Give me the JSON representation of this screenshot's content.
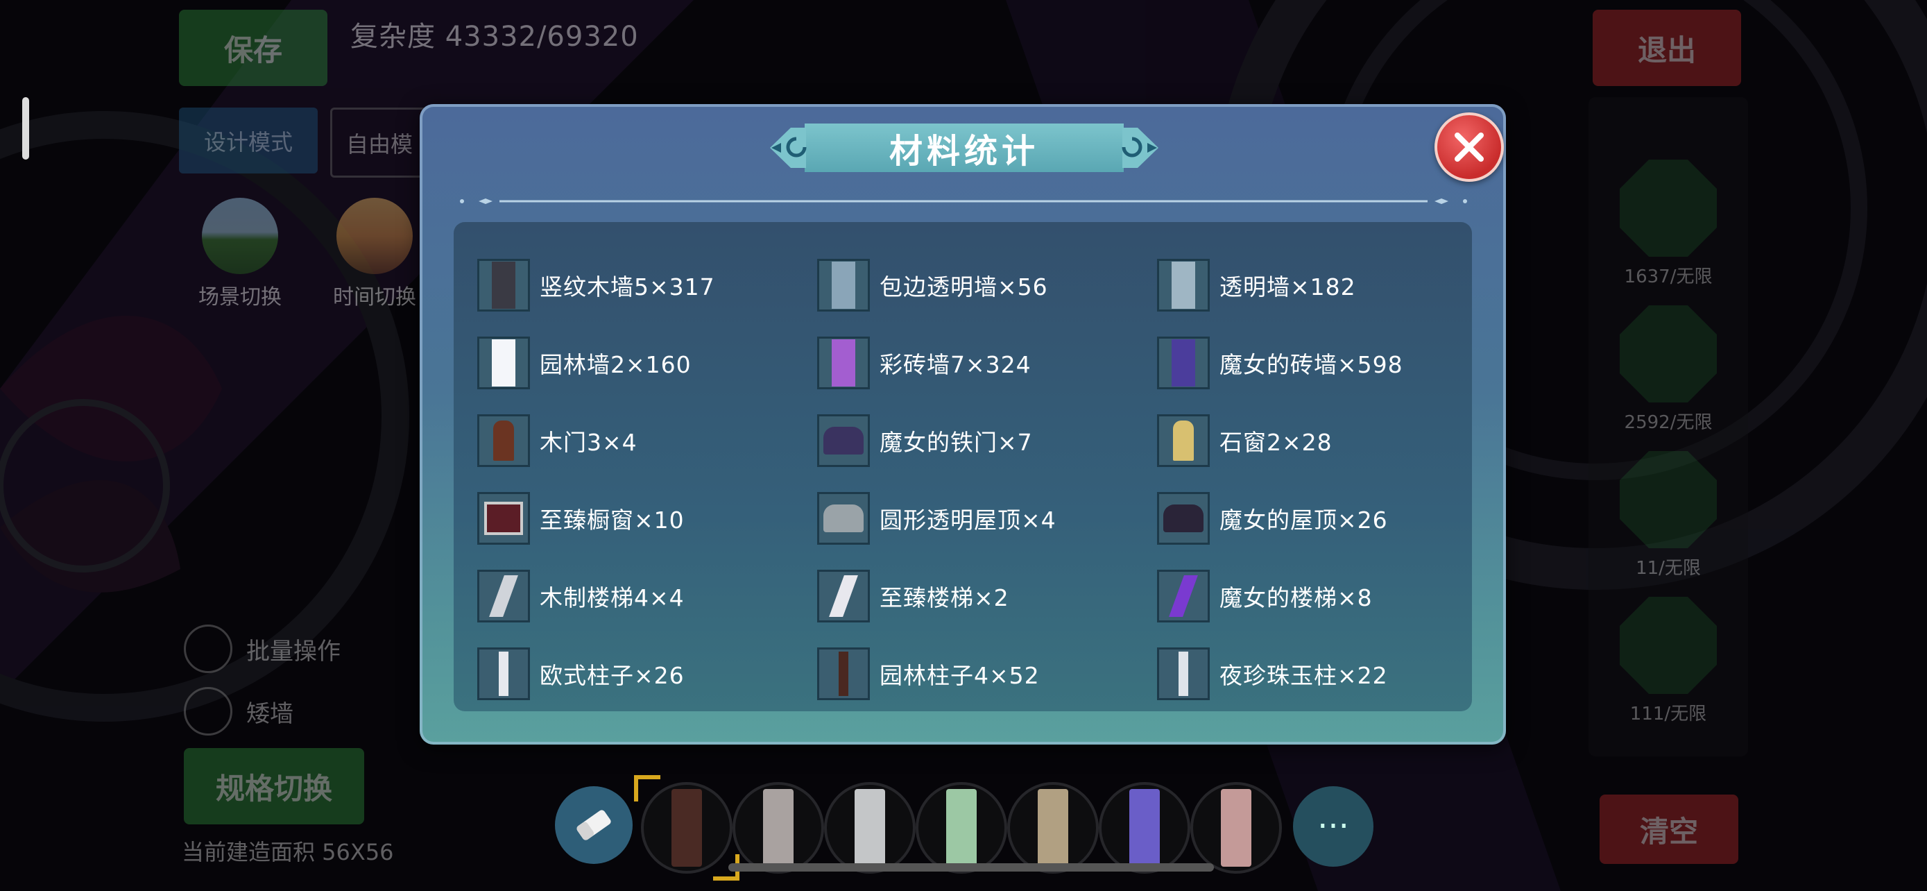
{
  "header": {
    "save_label": "保存",
    "complexity": "复杂度 43332/69320",
    "exit_label": "退出"
  },
  "modes": {
    "design_label": "设计模式",
    "free_label": "自由模"
  },
  "scene": {
    "scene_switch": "场景切换",
    "time_switch": "时间切换"
  },
  "options": {
    "batch_label": "批量操作",
    "low_wall_label": "矮墙",
    "spec_switch_label": "规格切换",
    "area_label": "当前建造面积 56X56"
  },
  "sidebar": {
    "items": [
      {
        "count": "1637/无限",
        "icon": "brick-wall-icon"
      },
      {
        "count": "2592/无限",
        "icon": "floor-pattern-icon"
      },
      {
        "count": "11/无限",
        "icon": "window-icon"
      },
      {
        "count": "111/无限",
        "icon": "stair-icon"
      }
    ],
    "clear_label": "清空"
  },
  "modal": {
    "title": "材料统计",
    "materials": [
      {
        "label": "竖纹木墙5×317",
        "icon": "wood-wall-icon",
        "color": "#3a3a44"
      },
      {
        "label": "包边透明墙×56",
        "icon": "glass-wall-edged-icon",
        "color": "#8aa5b8"
      },
      {
        "label": "透明墙×182",
        "icon": "glass-wall-icon",
        "color": "#9fb6c4"
      },
      {
        "label": "园林墙2×160",
        "icon": "garden-wall-icon",
        "color": "#f4f6fa"
      },
      {
        "label": "彩砖墙7×324",
        "icon": "color-brick-wall-icon",
        "color": "#a35ed0"
      },
      {
        "label": "魔女的砖墙×598",
        "icon": "witch-brick-wall-icon",
        "color": "#4b3d9c"
      },
      {
        "label": "木门3×4",
        "icon": "wood-door-icon",
        "color": "#6b3422"
      },
      {
        "label": "魔女的铁门×7",
        "icon": "witch-iron-gate-icon",
        "color": "#3a3360"
      },
      {
        "label": "石窗2×28",
        "icon": "stone-window-icon",
        "color": "#d8c070"
      },
      {
        "label": "至臻橱窗×10",
        "icon": "display-window-icon",
        "color": "#5b1d26"
      },
      {
        "label": "圆形透明屋顶×4",
        "icon": "round-glass-roof-icon",
        "color": "#9aa3a8"
      },
      {
        "label": "魔女的屋顶×26",
        "icon": "witch-roof-icon",
        "color": "#2a2438"
      },
      {
        "label": "木制楼梯4×4",
        "icon": "wood-stairs-icon",
        "color": "#d0d4da"
      },
      {
        "label": "至臻楼梯×2",
        "icon": "premium-stairs-icon",
        "color": "#e8e8ee"
      },
      {
        "label": "魔女的楼梯×8",
        "icon": "witch-stairs-icon",
        "color": "#7a3ad0"
      },
      {
        "label": "欧式柱子×26",
        "icon": "european-pillar-icon",
        "color": "#e6e8ee"
      },
      {
        "label": "园林柱子4×52",
        "icon": "garden-pillar-icon",
        "color": "#4a2820"
      },
      {
        "label": "夜珍珠玉柱×22",
        "icon": "pearl-pillar-icon",
        "color": "#dfe4ea"
      }
    ]
  },
  "toolbar": {
    "slots": [
      {
        "icon": "brown-wall-swatch-icon",
        "color": "#4a2a24",
        "selected": true
      },
      {
        "icon": "panel-wall-swatch-icon",
        "color": "#a9a2a0",
        "selected": false
      },
      {
        "icon": "grey-wall-swatch-icon",
        "color": "#c4c6c8",
        "selected": false
      },
      {
        "icon": "green-wall-swatch-icon",
        "color": "#9cc8a4",
        "selected": false
      },
      {
        "icon": "window-wall-swatch-icon",
        "color": "#b1a082",
        "selected": false
      },
      {
        "icon": "purple-window-swatch-icon",
        "color": "#6a5ec8",
        "selected": false
      },
      {
        "icon": "pink-window-swatch-icon",
        "color": "#c49a98",
        "selected": false
      }
    ],
    "more_label": "···"
  }
}
